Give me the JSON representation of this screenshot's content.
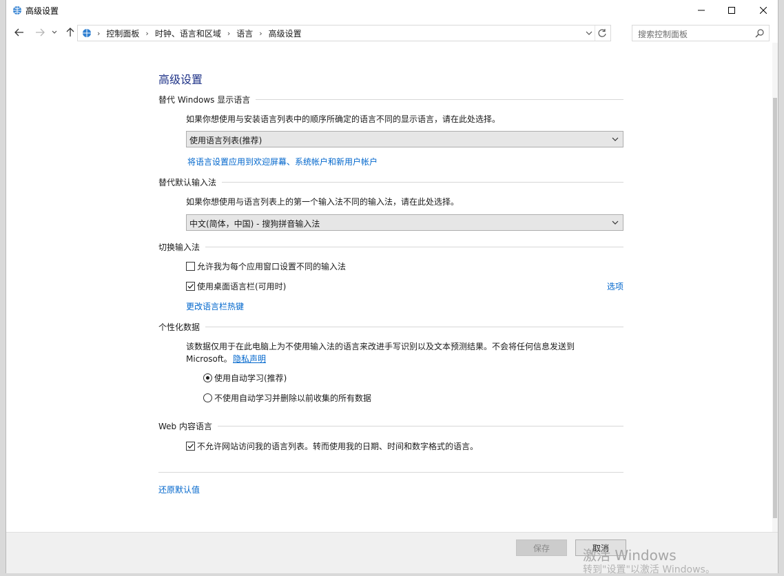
{
  "window": {
    "title": "高级设置",
    "colors": {
      "link": "#0066cc",
      "title": "#1e3287"
    }
  },
  "nav": {
    "breadcrumb": [
      "控制面板",
      "时钟、语言和区域",
      "语言",
      "高级设置"
    ],
    "search_placeholder": "搜索控制面板"
  },
  "main": {
    "page_title": "高级设置",
    "display_lang": {
      "heading": "替代 Windows 显示语言",
      "description": "如果你想使用与安装语言列表中的顺序所确定的语言不同的显示语言，请在此处选择。",
      "selected": "使用语言列表(推荐)",
      "apply_link": "将语言设置应用到欢迎屏幕、系统帐户和新用户帐户"
    },
    "input_method": {
      "heading": "替代默认输入法",
      "description": "如果你想使用与语言列表上的第一个输入法不同的输入法，请在此处选择。",
      "selected": "中文(简体，中国) - 搜狗拼音输入法"
    },
    "switch_input": {
      "heading": "切换输入法",
      "per_app_label": "允许我为每个应用窗口设置不同的输入法",
      "per_app_checked": false,
      "langbar_label": "使用桌面语言栏(可用时)",
      "langbar_checked": true,
      "options_link": "选项",
      "hotkeys_link": "更改语言栏热键"
    },
    "personalization": {
      "heading": "个性化数据",
      "description_line1": "该数据仅用于在此电脑上为不使用输入法的语言来改进手写识别以及文本预测结果。不会将任何信息发送到",
      "description_line2": "Microsoft。",
      "privacy_link": "隐私声明",
      "radio_auto": "使用自动学习(推荐)",
      "radio_no_auto": "不使用自动学习并删除以前收集的所有数据",
      "selected": "auto"
    },
    "web_content": {
      "heading": "Web 内容语言",
      "checkbox_label": "不允许网站访问我的语言列表。转而使用我的日期、时间和数字格式的语言。",
      "checked": true
    },
    "restore_link": "还原默认值"
  },
  "footer": {
    "save_label": "保存",
    "cancel_label": "取消"
  },
  "watermark": {
    "line1": "激活 Windows",
    "line2": "转到\"设置\"以激活 Windows。"
  }
}
